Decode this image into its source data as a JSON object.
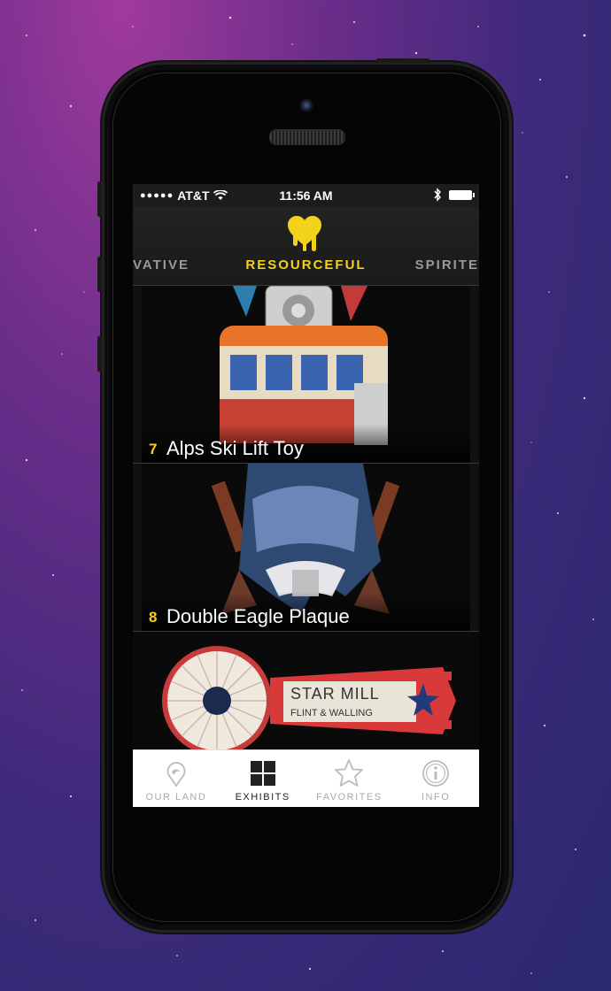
{
  "status_bar": {
    "carrier": "AT&T",
    "time": "11:56 AM"
  },
  "header": {
    "prev_category": "VATIVE",
    "current_category": "RESOURCEFUL",
    "next_category": "SPIRITE",
    "accent_color": "#f2d21a"
  },
  "exhibits": [
    {
      "number": "7",
      "title": "Alps Ski Lift Toy"
    },
    {
      "number": "8",
      "title": "Double Eagle Plaque"
    },
    {
      "number": "",
      "title": ""
    }
  ],
  "artwork_text": {
    "star_mill": "STAR MILL",
    "flint": "FLINT & WALLING"
  },
  "tabbar": {
    "tabs": [
      {
        "label": "OUR LAND",
        "icon": "map-pin-icon"
      },
      {
        "label": "EXHIBITS",
        "icon": "grid-icon",
        "active": true
      },
      {
        "label": "FAVORITES",
        "icon": "star-icon"
      },
      {
        "label": "INFO",
        "icon": "info-icon"
      }
    ]
  }
}
